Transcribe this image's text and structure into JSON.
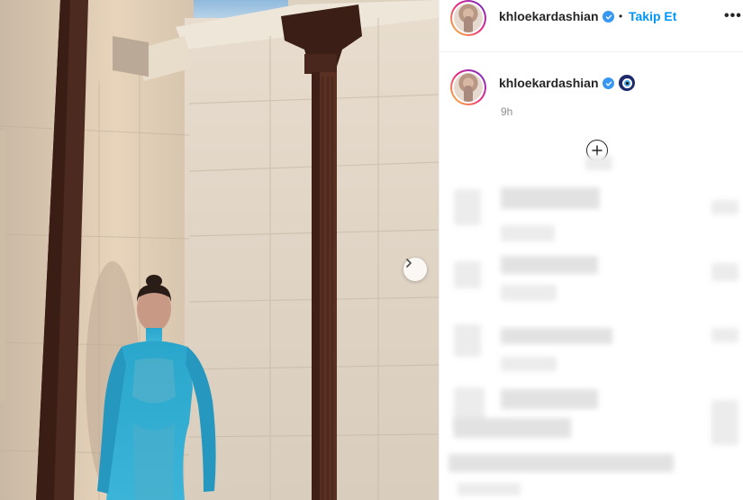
{
  "post": {
    "author": {
      "username": "khloekardashian",
      "verified": true
    },
    "follow_label": "Takip Et",
    "separator": "•",
    "more_label": "•••",
    "caption": {
      "username": "khloekardashian",
      "emoji_icon": "nazar-evil-eye-icon"
    },
    "time_ago": "9h",
    "load_more_icon": "plus-circle-icon",
    "comments_blurred": true
  },
  "photo": {
    "next_icon": "chevron-right-icon",
    "dress_color": "#2aa6cc"
  },
  "colors": {
    "accent": "#0095f6",
    "verified": "#3897f0",
    "text": "#262626",
    "muted": "#8e8e8e"
  }
}
